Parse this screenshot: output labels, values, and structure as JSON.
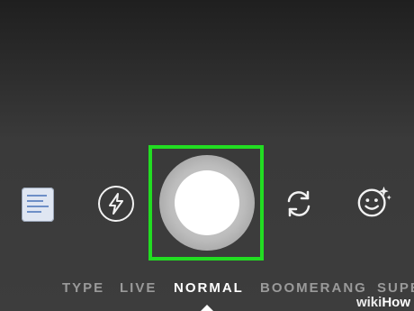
{
  "controls": {
    "gallery_icon": "gallery-thumbnail-icon",
    "flash_icon": "lightning-bolt-icon",
    "switch_icon": "camera-switch-icon",
    "face_icon": "face-effects-icon",
    "shutter_icon": "shutter-button"
  },
  "modes": {
    "items": [
      {
        "label": "TYPE"
      },
      {
        "label": "LIVE"
      },
      {
        "label": "NORMAL"
      },
      {
        "label": "BOOMERANG"
      },
      {
        "label": "SUPE"
      }
    ],
    "selected": "NORMAL"
  },
  "highlight": {
    "color": "#22dd22"
  },
  "watermark": {
    "wiki": "wiki",
    "how": "How"
  }
}
